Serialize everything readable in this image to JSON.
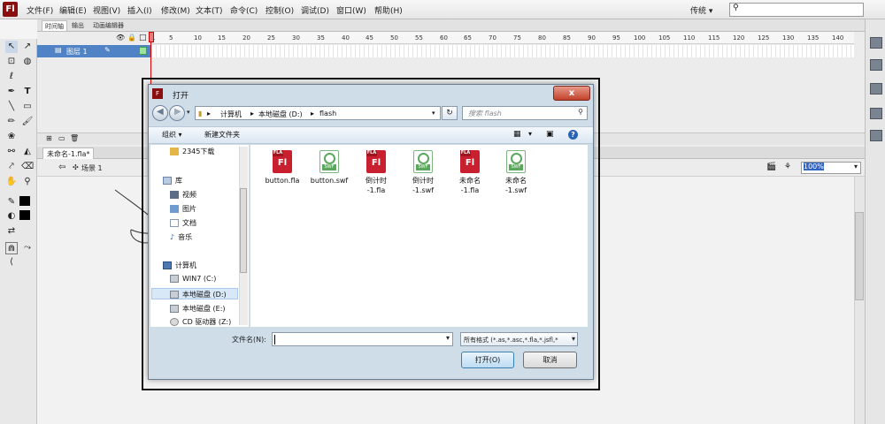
{
  "app": {
    "logo_text": "Fl"
  },
  "menu": [
    "文件(F)",
    "编辑(E)",
    "视图(V)",
    "插入(I)",
    "修改(M)",
    "文本(T)",
    "命令(C)",
    "控制(O)",
    "调试(D)",
    "窗口(W)",
    "帮助(H)"
  ],
  "workspace": "传统 ▾",
  "timeline": {
    "tabs": [
      "时间轴",
      "输出",
      "动画编辑器"
    ],
    "layer_name": "图层 1",
    "frame_numbers": [
      "1",
      "5",
      "10",
      "15",
      "20",
      "25",
      "30",
      "35",
      "40",
      "45",
      "50",
      "55",
      "60",
      "65",
      "70",
      "75",
      "80",
      "85",
      "90",
      "95",
      "100",
      "105",
      "110",
      "115",
      "120",
      "125",
      "130",
      "135",
      "140"
    ]
  },
  "document": {
    "tab": "未命名-1.fla*",
    "scene": "场景 1",
    "zoom": "100%"
  },
  "dialog": {
    "title": "打开",
    "close": "x",
    "breadcrumb": [
      "计算机",
      "本地磁盘 (D:)",
      "flash"
    ],
    "search_placeholder": "搜索 flash",
    "organize": "组织 ▾",
    "new_folder": "新建文件夹",
    "nav_items": [
      {
        "label": "2345下载",
        "icon": "folder-icon"
      },
      {
        "label": "库",
        "icon": "library-icon"
      },
      {
        "label": "视频",
        "icon": "video-icon"
      },
      {
        "label": "图片",
        "icon": "picture-icon"
      },
      {
        "label": "文档",
        "icon": "document-icon"
      },
      {
        "label": "音乐",
        "icon": "music-icon"
      },
      {
        "label": "计算机",
        "icon": "computer-icon"
      },
      {
        "label": "WIN7 (C:)",
        "icon": "drive-icon"
      },
      {
        "label": "本地磁盘 (D:)",
        "icon": "drive-icon"
      },
      {
        "label": "本地磁盘 (E:)",
        "icon": "drive-icon"
      },
      {
        "label": "CD 驱动器 (Z:)",
        "icon": "cd-drive-icon"
      }
    ],
    "files": [
      {
        "line1": "button.fla",
        "line2": "",
        "type": "fla"
      },
      {
        "line1": "button.swf",
        "line2": "",
        "type": "swf"
      },
      {
        "line1": "倒计时",
        "line2": "-1.fla",
        "type": "fla"
      },
      {
        "line1": "倒计时",
        "line2": "-1.swf",
        "type": "swf"
      },
      {
        "line1": "未命名",
        "line2": "-1.fla",
        "type": "fla"
      },
      {
        "line1": "未命名",
        "line2": "-1.swf",
        "type": "swf"
      }
    ],
    "filename_label": "文件名(N):",
    "filename_value": "",
    "filetype": "所有格式 (*.as,*.asc,*.fla,*.jsfl,*",
    "open_button": "打开(O)",
    "cancel_button": "取消"
  },
  "colors": {
    "accent": "#3165c0",
    "flash_red": "#c8202e",
    "swf_green": "#5aa85c"
  }
}
